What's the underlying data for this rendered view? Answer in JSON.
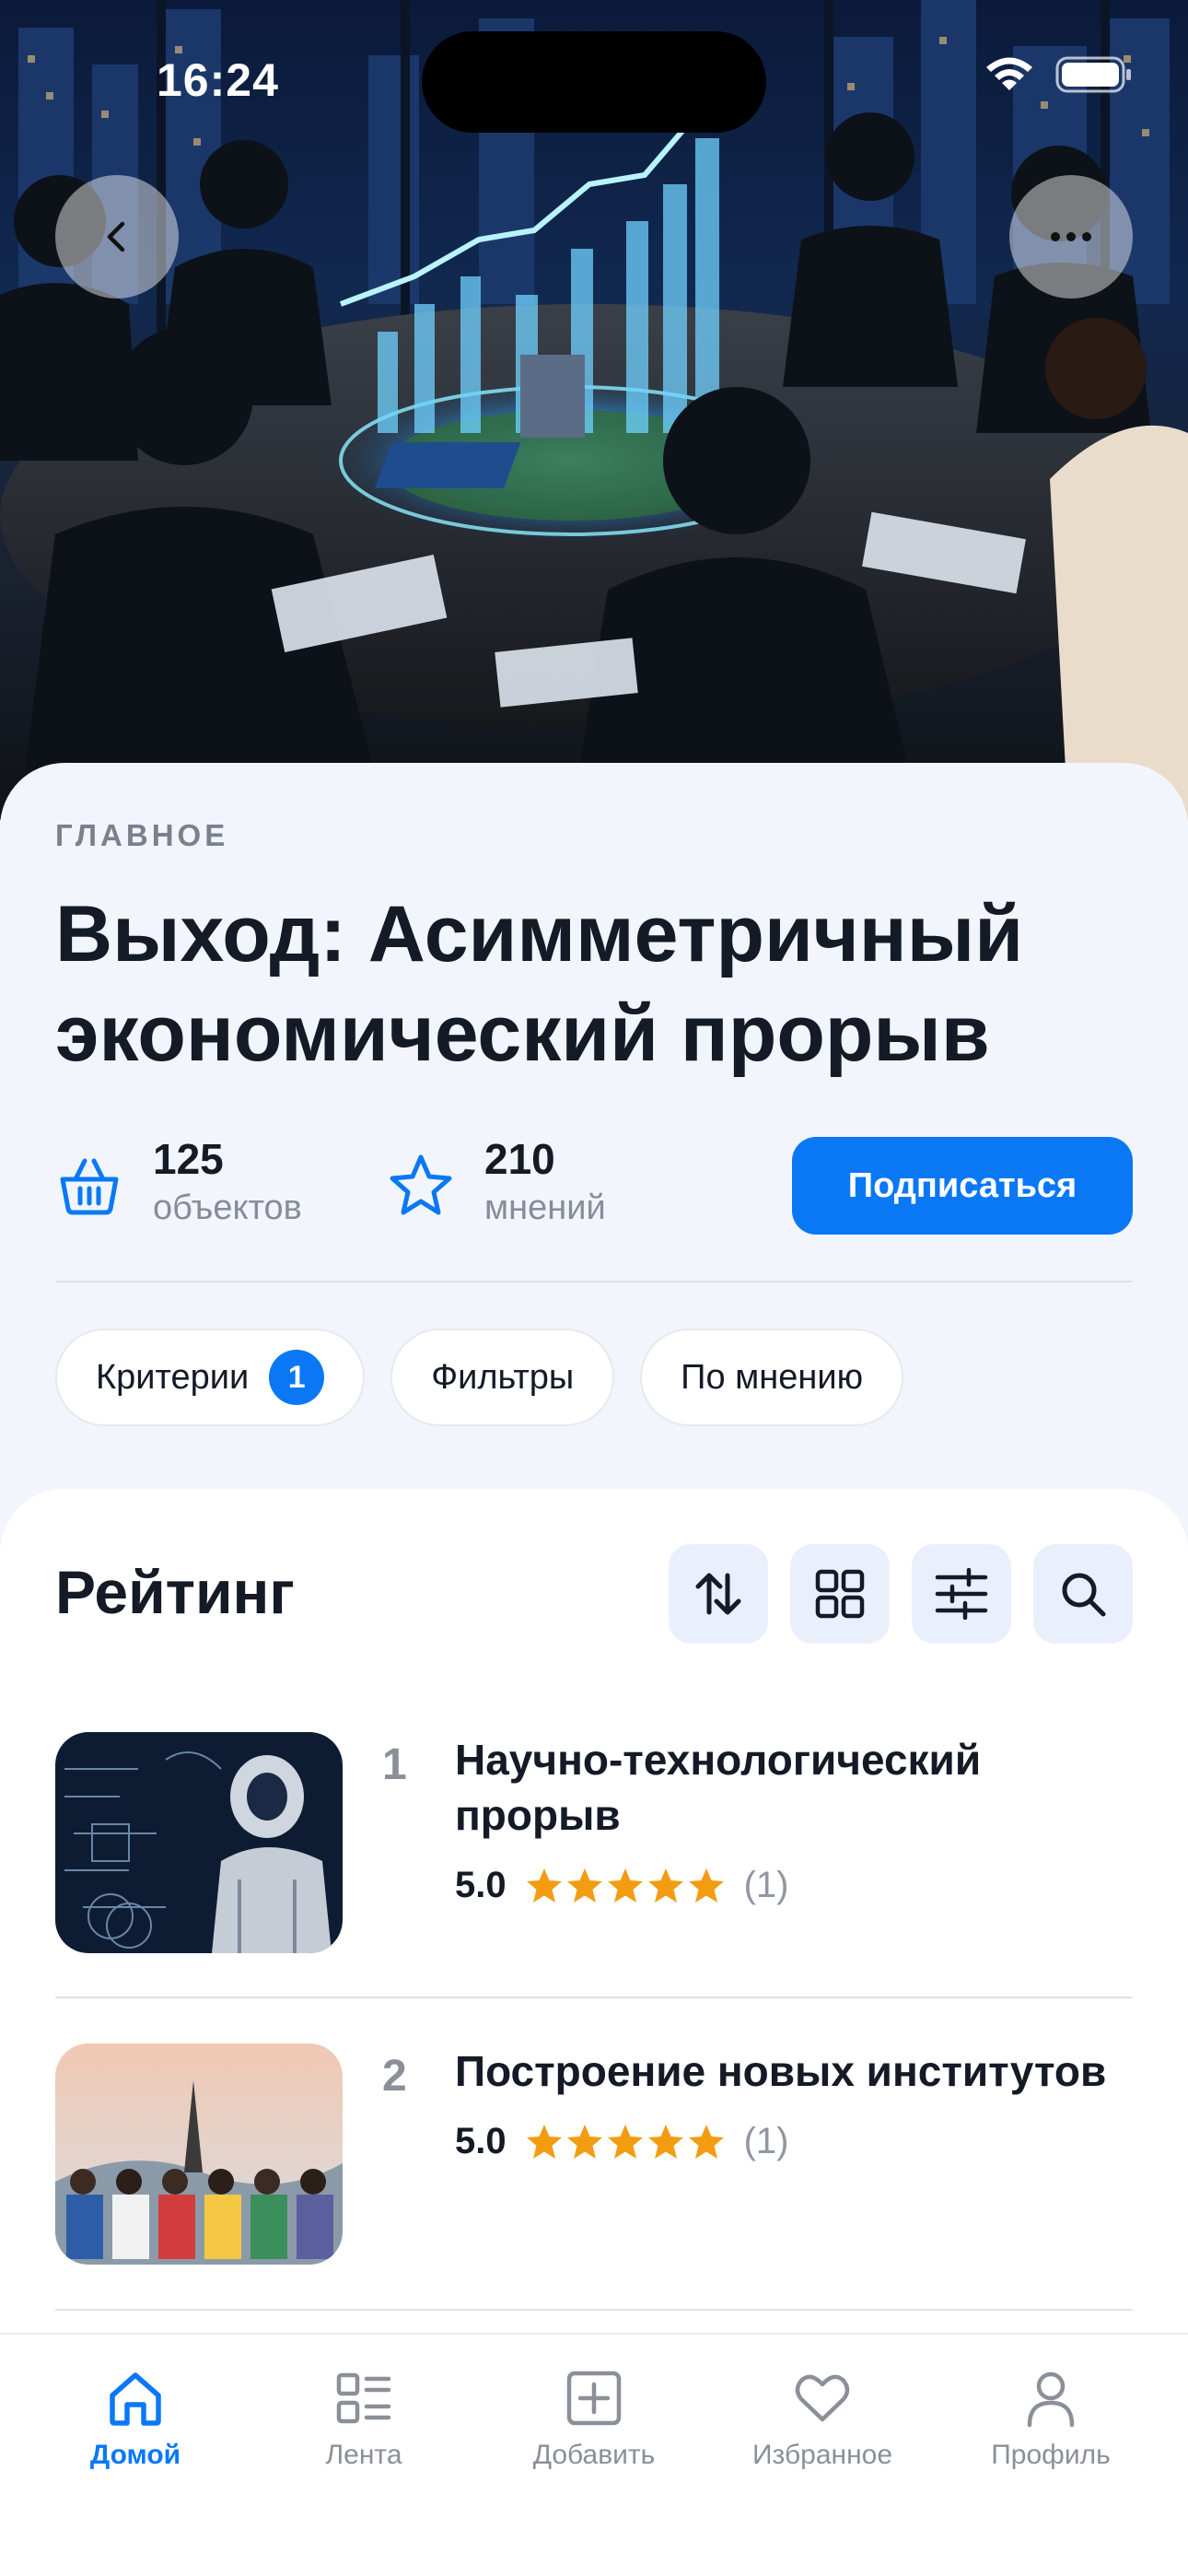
{
  "status_bar": {
    "time": "16:24"
  },
  "header": {
    "eyebrow": "ГЛАВНОЕ",
    "title": "Выход: Асимметричный экономический прорыв"
  },
  "stats": {
    "objects": {
      "value": "125",
      "label": "объектов",
      "icon": "basket-icon"
    },
    "reviews": {
      "value": "210",
      "label": "мнений",
      "icon": "star-outline-icon"
    }
  },
  "subscribe_label": "Подписаться",
  "chips": [
    {
      "label": "Критерии",
      "badge": "1"
    },
    {
      "label": "Фильтры"
    },
    {
      "label": "По мнению"
    }
  ],
  "ranking": {
    "title": "Рейтинг",
    "tools": [
      "sort-icon",
      "grid-icon",
      "sliders-icon",
      "search-icon"
    ],
    "items": [
      {
        "rank": "1",
        "title": "Научно-технологический прорыв",
        "score": "5.0",
        "stars": 5,
        "count": "(1)"
      },
      {
        "rank": "2",
        "title": "Построение новых институтов",
        "score": "5.0",
        "stars": 5,
        "count": "(1)"
      }
    ]
  },
  "tabs": [
    {
      "label": "Домой",
      "icon": "home-icon",
      "active": true
    },
    {
      "label": "Лента",
      "icon": "feed-icon"
    },
    {
      "label": "Добавить",
      "icon": "add-icon"
    },
    {
      "label": "Избранное",
      "icon": "heart-icon"
    },
    {
      "label": "Профиль",
      "icon": "profile-icon"
    }
  ],
  "colors": {
    "accent": "#0a78f5",
    "star": "#f39c12",
    "background": "#f2f6fc"
  }
}
